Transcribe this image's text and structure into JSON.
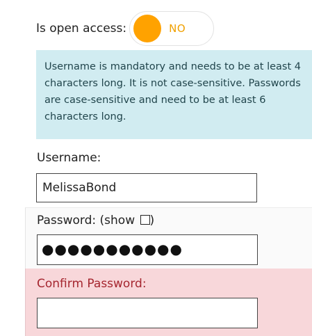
{
  "open_access": {
    "label": "Is open access:",
    "toggle_text": "NO",
    "toggle_state": "off",
    "knob_color": "#ffa200"
  },
  "info": {
    "text": "Username is mandatory and needs to be at least 4 characters long. It is not case-sensitive. Passwords are case-sensitive and need to be at least 6 characters long."
  },
  "username": {
    "label": "Username:",
    "value": "MelissaBond"
  },
  "password": {
    "label": "Password: (show ",
    "label_end": ")",
    "masked_value": "●●●●●●●●●●●",
    "show_checked": false
  },
  "confirm_password": {
    "label": "Confirm Password:",
    "value": "",
    "error_color": "#f8d7da"
  }
}
